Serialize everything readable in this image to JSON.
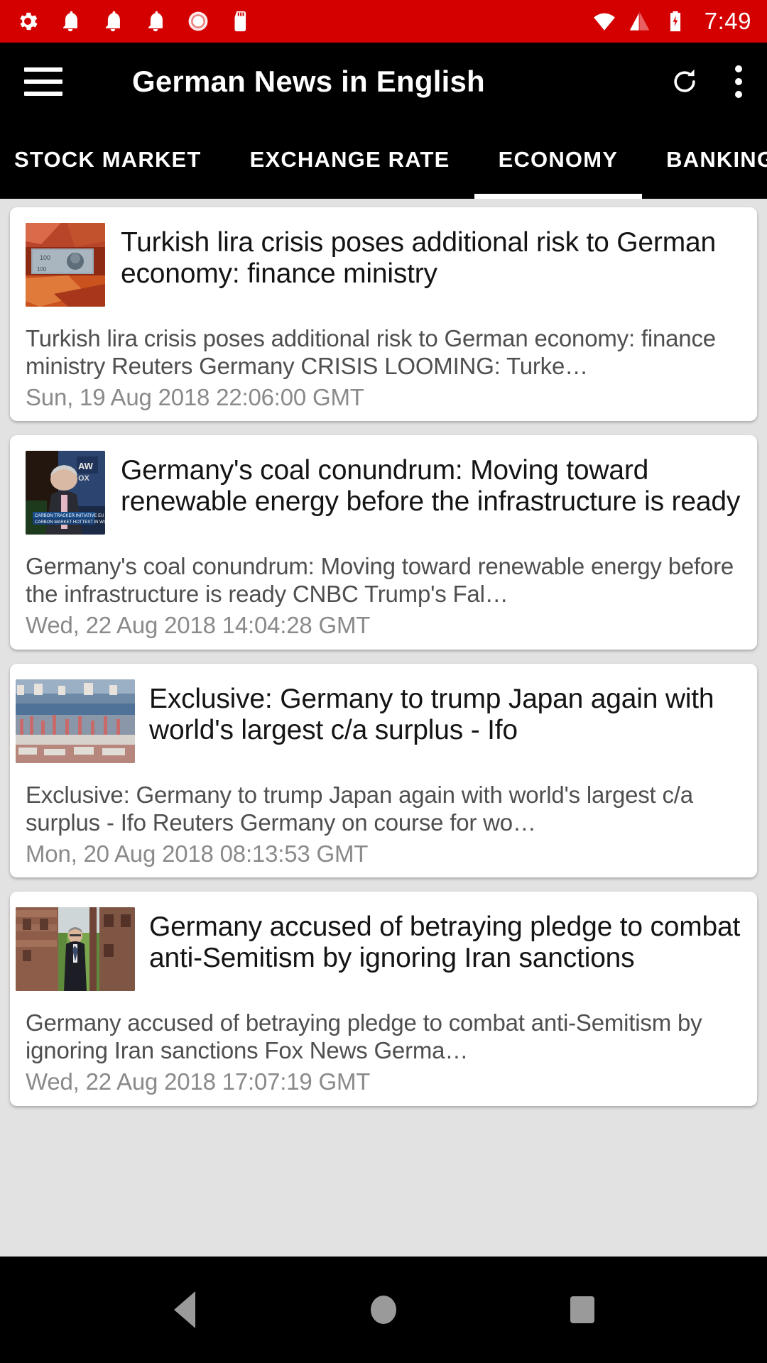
{
  "status_bar": {
    "background": "#d40000",
    "left_icons": [
      "settings-gear-icon",
      "notification-bell-icon",
      "notification-bell-icon",
      "notification-bell-icon",
      "alarm-clock-icon",
      "sd-card-icon"
    ],
    "right_icons": [
      "wifi-icon",
      "cellular-signal-icon",
      "battery-charging-icon"
    ],
    "clock": "7:49"
  },
  "app_bar": {
    "background": "#000000",
    "menu_icon": "hamburger-menu-icon",
    "title": "German News in English",
    "refresh_icon": "refresh-icon",
    "overflow_icon": "more-vertical-icon"
  },
  "tabs": {
    "selected_index": 2,
    "indicator_color": "#ffffff",
    "items": [
      {
        "label": "STOCK MARKET"
      },
      {
        "label": "EXCHANGE RATE"
      },
      {
        "label": "ECONOMY"
      },
      {
        "label": "BANKING"
      }
    ]
  },
  "news": {
    "items": [
      {
        "thumbnail": "turkish-lira-banknotes-thumbnail",
        "title": "Turkish lira crisis poses additional risk to German economy: finance ministry",
        "description": "Turkish lira crisis poses additional risk to German economy: finance ministry  Reuters  Germany CRISIS LOOMING: Turke…",
        "date": "Sun, 19 Aug 2018 22:06:00 GMT"
      },
      {
        "thumbnail": "tv-interview-coal-thumbnail",
        "title": "Germany's coal conundrum: Moving toward renewable energy before the infrastructure is ready",
        "description": "Germany's coal conundrum: Moving toward renewable energy before the infrastructure is ready  CNBC  Trump's Fal…",
        "date": "Wed, 22 Aug 2018 14:04:28 GMT"
      },
      {
        "thumbnail": "hamburg-port-aerial-thumbnail",
        "title": "Exclusive: Germany to trump Japan again with world's largest c/a surplus - Ifo",
        "description": "Exclusive: Germany to trump Japan again with world's largest c/a surplus - Ifo  Reuters  Germany on course for wo…",
        "date": "Mon, 20 Aug 2018 08:13:53 GMT"
      },
      {
        "thumbnail": "man-walking-memorial-thumbnail",
        "title": "Germany accused of betraying pledge to combat anti-Semitism by ignoring Iran sanctions",
        "description": "Germany accused of betraying pledge to combat anti-Semitism by ignoring Iran sanctions  Fox News  Germa…",
        "date": "Wed, 22 Aug 2018 17:07:19 GMT"
      }
    ]
  },
  "nav_bar": {
    "back_icon": "back-triangle-icon",
    "home_icon": "home-circle-icon",
    "recents_icon": "recents-square-icon"
  }
}
